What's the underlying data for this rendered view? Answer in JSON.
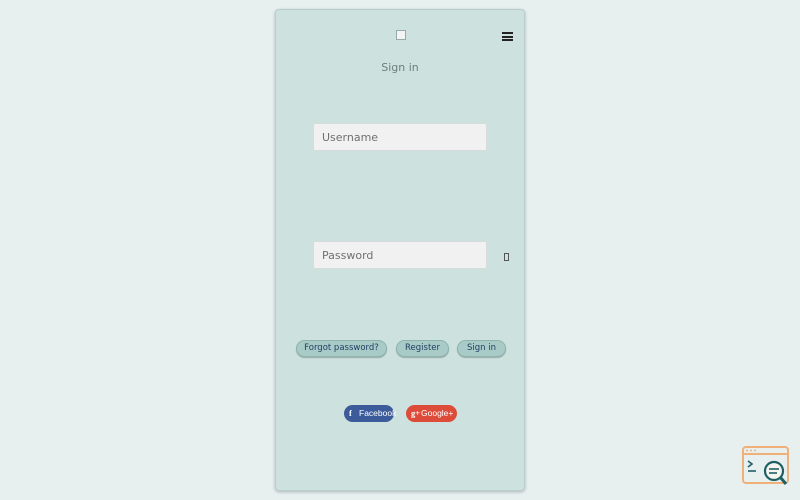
{
  "header": {
    "title": "Sign in"
  },
  "form": {
    "username_placeholder": "Username",
    "password_placeholder": "Password"
  },
  "actions": {
    "forgot_label": "Forgot password?",
    "register_label": "Register",
    "signin_label": "Sign in"
  },
  "social": {
    "facebook_label": "Facebook",
    "facebook_icon": "f",
    "google_label": "Google+",
    "google_icon": "g+"
  },
  "colors": {
    "page_background": "#e7f0ef",
    "card_background": "#cde2de",
    "button_background": "#a9cbc7",
    "button_text": "#1f3f63",
    "facebook": "#3b5b9a",
    "google": "#dd4b39",
    "corner_logo_orange": "#f0b07a",
    "corner_logo_teal": "#1f5f66"
  },
  "icons": {
    "menu": "hamburger-menu-icon",
    "password_toggle": "eye-icon",
    "corner": "search-code-icon"
  }
}
